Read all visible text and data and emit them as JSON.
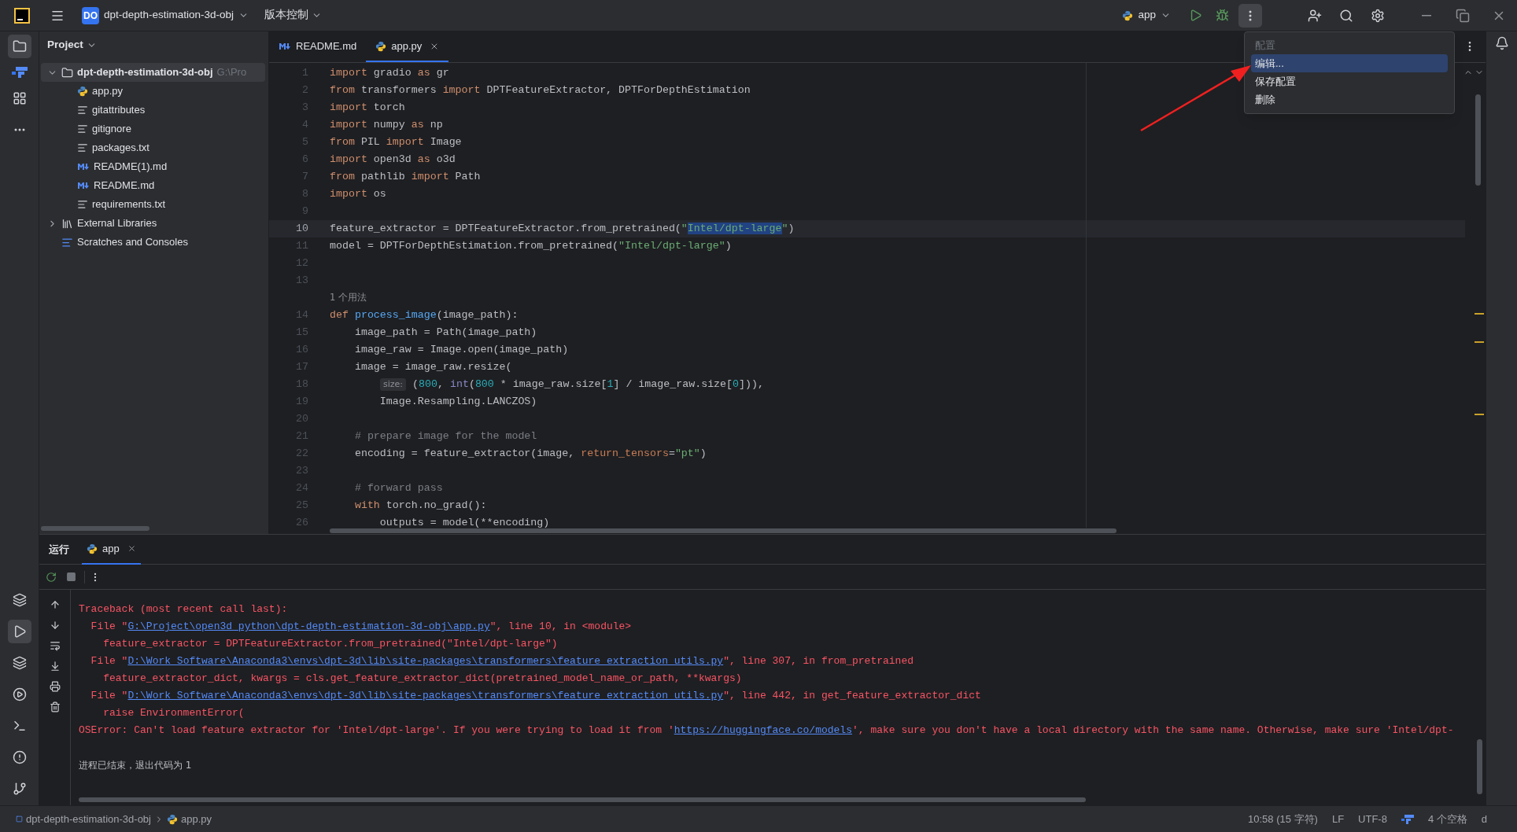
{
  "title_bar": {
    "badge": "DO",
    "project": "dpt-depth-estimation-3d-obj",
    "vcs": "版本控制",
    "run_config": "app"
  },
  "project_panel": {
    "title": "Project",
    "tree": [
      {
        "label": "dpt-depth-estimation-3d-obj",
        "path": "G:\\Pro",
        "kind": "folder",
        "expanded": true,
        "selected": true,
        "children": [
          {
            "label": "app.py",
            "kind": "python",
            "selected": false
          },
          {
            "label": "gitattributes",
            "kind": "text",
            "selected": false
          },
          {
            "label": "gitignore",
            "kind": "text",
            "selected": false
          },
          {
            "label": "packages.txt",
            "kind": "text",
            "selected": false
          },
          {
            "label": "README(1).md",
            "kind": "markdown",
            "selected": false
          },
          {
            "label": "README.md",
            "kind": "markdown",
            "selected": false
          },
          {
            "label": "requirements.txt",
            "kind": "text",
            "selected": false
          }
        ]
      },
      {
        "label": "External Libraries",
        "kind": "library",
        "expanded": false,
        "selected": false
      },
      {
        "label": "Scratches and Consoles",
        "kind": "scratch",
        "selected": false
      }
    ]
  },
  "editor_tabs": [
    {
      "label": "README.md",
      "kind": "markdown",
      "selected": false
    },
    {
      "label": "app.py",
      "kind": "python",
      "selected": true
    }
  ],
  "code": [
    {
      "number": "1",
      "current": false,
      "tokens": [
        {
          "kind": "k",
          "text": "import"
        },
        {
          "kind": "t",
          "text": " gradio "
        },
        {
          "kind": "k",
          "text": "as"
        },
        {
          "kind": "t",
          "text": " gr"
        }
      ]
    },
    {
      "number": "2",
      "current": false,
      "tokens": [
        {
          "kind": "k",
          "text": "from"
        },
        {
          "kind": "t",
          "text": " transformers "
        },
        {
          "kind": "k",
          "text": "import"
        },
        {
          "kind": "t",
          "text": " DPTFeatureExtractor, DPTForDepthEstimation"
        }
      ]
    },
    {
      "number": "3",
      "current": false,
      "tokens": [
        {
          "kind": "k",
          "text": "import"
        },
        {
          "kind": "t",
          "text": " torch"
        }
      ]
    },
    {
      "number": "4",
      "current": false,
      "tokens": [
        {
          "kind": "k",
          "text": "import"
        },
        {
          "kind": "t",
          "text": " numpy "
        },
        {
          "kind": "k",
          "text": "as"
        },
        {
          "kind": "t",
          "text": " np"
        }
      ]
    },
    {
      "number": "5",
      "current": false,
      "tokens": [
        {
          "kind": "k",
          "text": "from"
        },
        {
          "kind": "t",
          "text": " PIL "
        },
        {
          "kind": "k",
          "text": "import"
        },
        {
          "kind": "t",
          "text": " Image"
        }
      ]
    },
    {
      "number": "6",
      "current": false,
      "tokens": [
        {
          "kind": "k",
          "text": "import"
        },
        {
          "kind": "t",
          "text": " open3d "
        },
        {
          "kind": "k",
          "text": "as"
        },
        {
          "kind": "t",
          "text": " o3d"
        }
      ]
    },
    {
      "number": "7",
      "current": false,
      "tokens": [
        {
          "kind": "k",
          "text": "from"
        },
        {
          "kind": "t",
          "text": " pathlib "
        },
        {
          "kind": "k",
          "text": "import"
        },
        {
          "kind": "t",
          "text": " Path"
        }
      ]
    },
    {
      "number": "8",
      "current": false,
      "tokens": [
        {
          "kind": "k",
          "text": "import"
        },
        {
          "kind": "t",
          "text": " os"
        }
      ]
    },
    {
      "number": "9",
      "current": false
    },
    {
      "number": "10",
      "current": true,
      "tokens": [
        {
          "kind": "t",
          "text": "feature_extractor = DPTFeatureExtractor.from_pretrained("
        },
        {
          "kind": "s",
          "text": "\""
        },
        {
          "kind": "sel",
          "text": "Intel/dpt-large"
        },
        {
          "kind": "s",
          "text": "\""
        },
        {
          "kind": "t",
          "text": ")"
        }
      ]
    },
    {
      "number": "11",
      "current": false,
      "tokens": [
        {
          "kind": "t",
          "text": "model = DPTForDepthEstimation.from_pretrained("
        },
        {
          "kind": "s",
          "text": "\"Intel/dpt-large\""
        },
        {
          "kind": "t",
          "text": ")"
        }
      ]
    },
    {
      "number": "12",
      "current": false
    },
    {
      "number": "13",
      "current": false
    },
    {
      "kind": "usage_hint",
      "text": "1 个用法"
    },
    {
      "number": "14",
      "current": false,
      "tokens": [
        {
          "kind": "k",
          "text": "def"
        },
        {
          "kind": "f",
          "text": " process_image"
        },
        {
          "kind": "t",
          "text": "(image_path):"
        }
      ]
    },
    {
      "number": "15",
      "current": false,
      "tokens": [
        {
          "kind": "t",
          "text": "    image_path = Path(image_path)"
        }
      ]
    },
    {
      "number": "16",
      "current": false,
      "tokens": [
        {
          "kind": "t",
          "text": "    image_raw = Image.open(image_path)"
        }
      ]
    },
    {
      "number": "17",
      "current": false,
      "tokens": [
        {
          "kind": "t",
          "text": "    image = image_raw.resize("
        }
      ]
    },
    {
      "number": "18",
      "current": false,
      "tokens": [
        {
          "kind": "h",
          "text": "size:"
        },
        {
          "kind": "t",
          "text": " ("
        },
        {
          "kind": "n",
          "text": "800"
        },
        {
          "kind": "t",
          "text": ", "
        },
        {
          "kind": "b",
          "text": "int"
        },
        {
          "kind": "t",
          "text": "("
        },
        {
          "kind": "n",
          "text": "800"
        },
        {
          "kind": "t",
          "text": " * image_raw.size["
        },
        {
          "kind": "n",
          "text": "1"
        },
        {
          "kind": "t",
          "text": "] / image_raw.size["
        },
        {
          "kind": "n",
          "text": "0"
        },
        {
          "kind": "t",
          "text": "])),"
        }
      ]
    },
    {
      "number": "19",
      "current": false,
      "tokens": [
        {
          "kind": "t",
          "text": "        Image.Resampling.LANCZOS)"
        }
      ]
    },
    {
      "number": "20",
      "current": false
    },
    {
      "number": "21",
      "current": false,
      "tokens": [
        {
          "kind": "c",
          "text": "    # prepare image for the model"
        }
      ]
    },
    {
      "number": "22",
      "current": false,
      "tokens": [
        {
          "kind": "t",
          "text": "    encoding = feature_extractor(image, "
        },
        {
          "kind": "p",
          "text": "return_tensors"
        },
        {
          "kind": "t",
          "text": "="
        },
        {
          "kind": "s",
          "text": "\"pt\""
        },
        {
          "kind": "t",
          "text": ")"
        }
      ]
    },
    {
      "number": "23",
      "current": false
    },
    {
      "number": "24",
      "current": false,
      "tokens": [
        {
          "kind": "c",
          "text": "    # forward pass"
        }
      ]
    },
    {
      "number": "25",
      "current": false,
      "tokens": [
        {
          "kind": "k",
          "text": "    with"
        },
        {
          "kind": "t",
          "text": " torch.no_grad():"
        }
      ]
    },
    {
      "number": "26",
      "current": false,
      "tokens": [
        {
          "kind": "t",
          "text": "        outputs = model(**encoding)"
        }
      ]
    }
  ],
  "context_menu": {
    "header": "配置",
    "items": [
      {
        "label": "编辑...",
        "selected": true
      },
      {
        "label": "保存配置",
        "selected": false
      },
      {
        "label": "删除",
        "selected": false
      }
    ]
  },
  "run_panel": {
    "tabs": [
      {
        "label": "运行",
        "kind": "title"
      },
      {
        "label": "app",
        "kind": "run",
        "selected": true
      }
    ],
    "output": [
      {
        "kind": "trace",
        "segments": [
          {
            "kind": "e",
            "text": "Traceback (most recent call last):"
          }
        ]
      },
      {
        "kind": "trace",
        "segments": [
          {
            "kind": "e",
            "text": "  File \""
          },
          {
            "kind": "l",
            "text": "G:\\Project\\open3d_python\\dpt-depth-estimation-3d-obj\\app.py"
          },
          {
            "kind": "e",
            "text": "\", line 10, in <module>"
          }
        ]
      },
      {
        "kind": "trace",
        "segments": [
          {
            "kind": "e",
            "text": "    feature_extractor = DPTFeatureExtractor.from_pretrained(\"Intel/dpt-large\")"
          }
        ]
      },
      {
        "kind": "trace",
        "segments": [
          {
            "kind": "e",
            "text": "  File \""
          },
          {
            "kind": "l",
            "text": "D:\\Work_Software\\Anaconda3\\envs\\dpt-3d\\lib\\site-packages\\transformers\\feature_extraction_utils.py"
          },
          {
            "kind": "e",
            "text": "\", line 307, in from_pretrained"
          }
        ]
      },
      {
        "kind": "trace",
        "segments": [
          {
            "kind": "e",
            "text": "    feature_extractor_dict, kwargs = cls.get_feature_extractor_dict(pretrained_model_name_or_path, **kwargs)"
          }
        ]
      },
      {
        "kind": "trace",
        "segments": [
          {
            "kind": "e",
            "text": "  File \""
          },
          {
            "kind": "l",
            "text": "D:\\Work_Software\\Anaconda3\\envs\\dpt-3d\\lib\\site-packages\\transformers\\feature_extraction_utils.py"
          },
          {
            "kind": "e",
            "text": "\", line 442, in get_feature_extractor_dict"
          }
        ]
      },
      {
        "kind": "trace",
        "segments": [
          {
            "kind": "e",
            "text": "    raise EnvironmentError("
          }
        ]
      },
      {
        "kind": "trace",
        "segments": [
          {
            "kind": "e",
            "text": "OSError: Can't load feature extractor for 'Intel/dpt-large'. If you were trying to load it from '"
          },
          {
            "kind": "l",
            "text": "https://huggingface.co/models"
          },
          {
            "kind": "e",
            "text": "', make sure you don't have a local directory with the same name. Otherwise, make sure 'Intel/dpt-"
          }
        ]
      },
      {
        "kind": "exit",
        "segments": [
          {
            "kind": "n",
            "text": "进程已结束，退出代码为 1"
          }
        ]
      }
    ]
  },
  "status_bar": {
    "breadcrumbs": [
      "dpt-depth-estimation-3d-obj",
      "app.py"
    ],
    "items": [
      "10:58 (15 字符)",
      "LF",
      "UTF-8",
      "4 个空格",
      "d"
    ]
  }
}
